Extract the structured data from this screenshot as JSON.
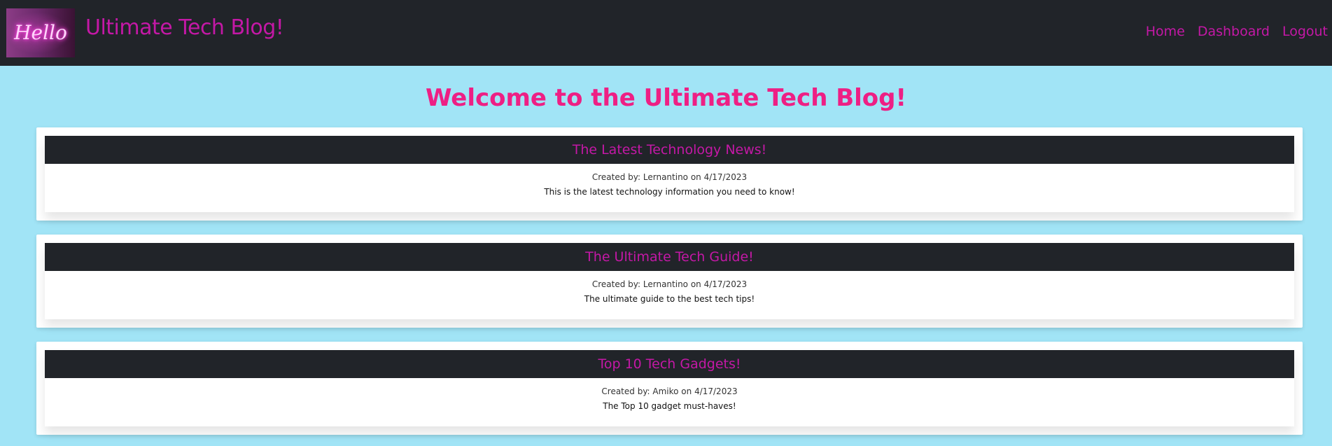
{
  "header": {
    "logo_text": "Hello",
    "site_title": "Ultimate Tech Blog!",
    "nav": [
      "Home",
      "Dashboard",
      "Logout"
    ]
  },
  "main": {
    "heading": "Welcome to the Ultimate Tech Blog!",
    "posts": [
      {
        "title": "The Latest Technology News!",
        "meta": "Created by: Lernantino on 4/17/2023",
        "body": "This is the latest technology information you need to know!"
      },
      {
        "title": "The Ultimate Tech Guide!",
        "meta": "Created by: Lernantino on 4/17/2023",
        "body": "The ultimate guide to the best tech tips!"
      },
      {
        "title": "Top 10 Tech Gadgets!",
        "meta": "Created by: Amiko on 4/17/2023",
        "body": "The Top 10 gadget must-haves!"
      }
    ]
  },
  "colors": {
    "background": "#a1e4f6",
    "navbar": "#212429",
    "accent": "#c418a6",
    "heading": "#ee1f84"
  }
}
